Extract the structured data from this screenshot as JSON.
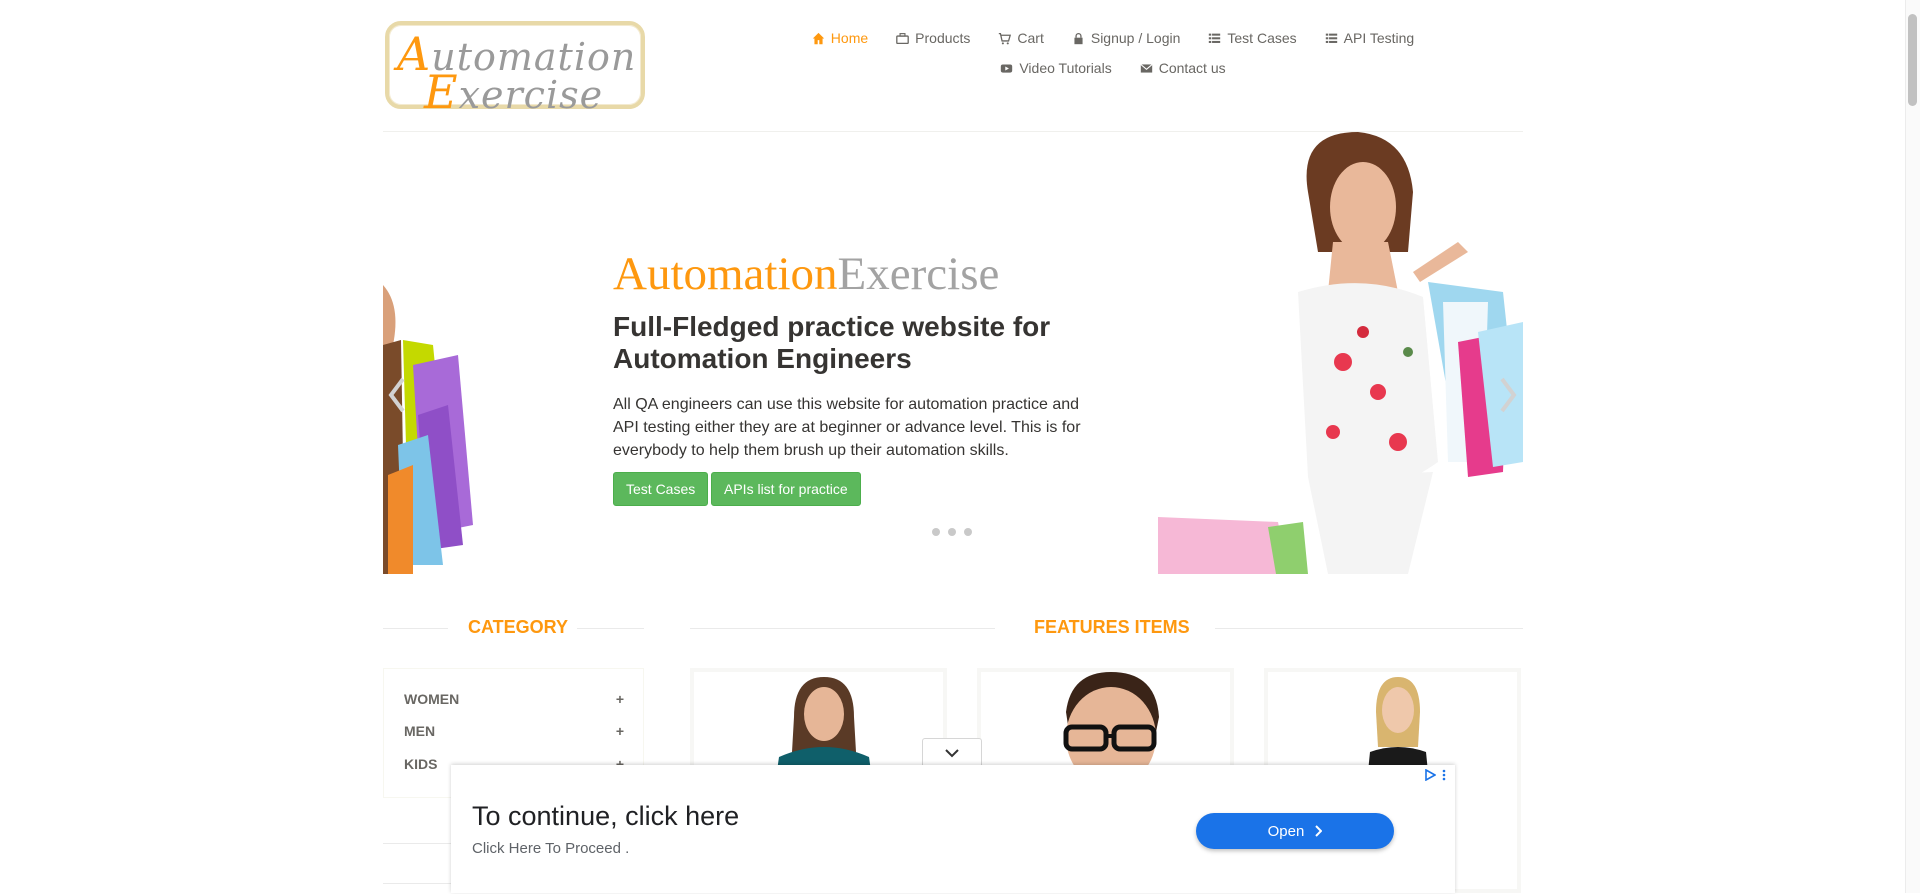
{
  "brand": {
    "logo_line1": "Automation",
    "logo_line2": "Exercise"
  },
  "nav": {
    "row1": [
      {
        "label": "Home",
        "icon": "home-icon",
        "active": true
      },
      {
        "label": "Products",
        "icon": "briefcase-icon"
      },
      {
        "label": "Cart",
        "icon": "cart-icon"
      },
      {
        "label": "Signup / Login",
        "icon": "lock-icon"
      },
      {
        "label": "Test Cases",
        "icon": "list-icon"
      },
      {
        "label": "API Testing",
        "icon": "list-icon"
      }
    ],
    "row2": [
      {
        "label": "Video Tutorials",
        "icon": "youtube-icon"
      },
      {
        "label": "Contact us",
        "icon": "envelope-icon"
      }
    ]
  },
  "hero": {
    "brand_a": "Automation",
    "brand_b": "Exercise",
    "title": "Full-Fledged practice website for Automation Engineers",
    "description": "All QA engineers can use this website for automation practice and API testing either they are at beginner or advance level. This is for everybody to help them brush up their automation skills.",
    "button_test_cases": "Test Cases",
    "button_apis": "APIs list for practice"
  },
  "sidebar": {
    "title": "Category",
    "items": [
      {
        "label": "WOMEN"
      },
      {
        "label": "MEN"
      },
      {
        "label": "KIDS"
      }
    ]
  },
  "features": {
    "title": "Features Items"
  },
  "ad": {
    "headline": "To continue, click here",
    "subtext": "Click Here To Proceed .",
    "button": "Open"
  },
  "colors": {
    "accent": "#fe980f",
    "button_green": "#5cb85c",
    "ad_blue": "#1a73e8"
  }
}
